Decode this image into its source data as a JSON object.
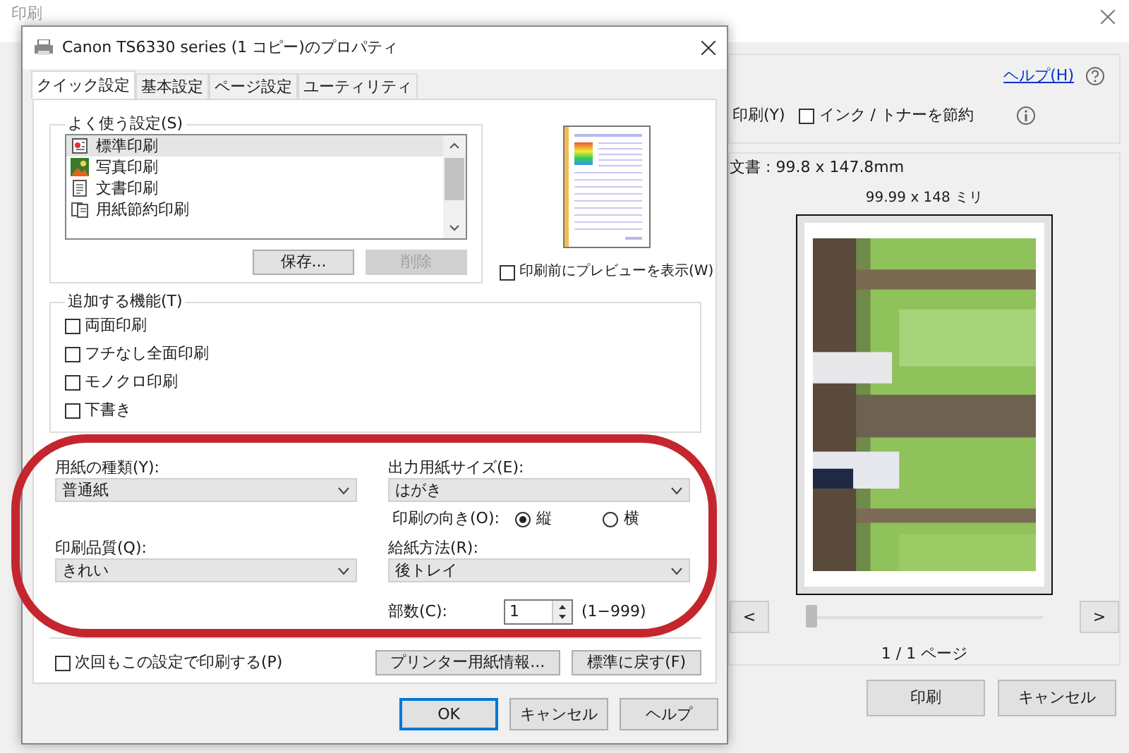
{
  "background_window": {
    "title": "印刷",
    "help_link": "ヘルプ(H)",
    "option_label": "印刷(Y)",
    "save_ink": {
      "label": "インク / トナーを節約",
      "checked": false
    },
    "document_size": "文書 : 99.8 x 147.8mm",
    "paper_size": "99.99 x 148 ミリ",
    "preview": {
      "kind": "picture"
    },
    "prev_button": "<",
    "next_button": ">",
    "page_slider": {
      "level": 0
    },
    "page_indicator": "1 / 1 ページ",
    "buttons": [
      "印刷",
      "キャンセル"
    ]
  },
  "dialog": {
    "title": "Canon TS6330 series (1 コピー)のプロパティ",
    "tabs": [
      {
        "label": "クイック設定",
        "selected": true
      },
      {
        "label": "基本設定",
        "selected": false
      },
      {
        "label": "ページ設定",
        "selected": false
      },
      {
        "label": "ユーティリティ",
        "selected": false
      }
    ],
    "favorites": {
      "label": "よく使う設定(S)",
      "items": [
        {
          "label": "標準印刷",
          "kind": "standard",
          "selected": true
        },
        {
          "label": "写真印刷",
          "selected": false
        },
        {
          "label": "文書印刷",
          "kind": "document",
          "selected": false
        },
        {
          "label": "用紙節約印刷",
          "kind": "saving",
          "selected": false
        }
      ],
      "buttons": [
        {
          "label": "保存...",
          "disabled": false
        },
        {
          "label": "削除",
          "disabled": true
        }
      ]
    },
    "preview_before_print": {
      "label": "印刷前にプレビューを表示(W)",
      "checked": false
    },
    "features": {
      "label": "追加する機能(T)",
      "items": [
        {
          "label": "両面印刷",
          "checked": false
        },
        {
          "label": "フチなし全面印刷",
          "checked": false
        },
        {
          "label": "モノクロ印刷",
          "checked": false
        },
        {
          "label": "下書き",
          "checked": false
        }
      ]
    },
    "media_type": {
      "label": "用紙の種類(Y):",
      "value": "普通紙"
    },
    "paper_size": {
      "label": "出力用紙サイズ(E):",
      "value": "はがき"
    },
    "orientation": {
      "label": "印刷の向き(O):",
      "options": [
        {
          "label": "縦",
          "selected": true
        },
        {
          "label": "横",
          "selected": false
        }
      ]
    },
    "quality": {
      "label": "印刷品質(Q):",
      "value": "きれい"
    },
    "paper_source": {
      "label": "給紙方法(R):",
      "value": "後トレイ"
    },
    "copies": {
      "label": "部数(C):",
      "value": "1",
      "range": "(1−999)"
    },
    "always_print": {
      "label": "次回もこの設定で印刷する(P)",
      "checked": false
    },
    "action_buttons": [
      "プリンター用紙情報...",
      "標準に戻す(F)"
    ],
    "footer_buttons": [
      {
        "label": "OK",
        "default": true
      },
      {
        "label": "キャンセル",
        "default": false
      },
      {
        "label": "ヘルプ",
        "default": false
      }
    ]
  }
}
